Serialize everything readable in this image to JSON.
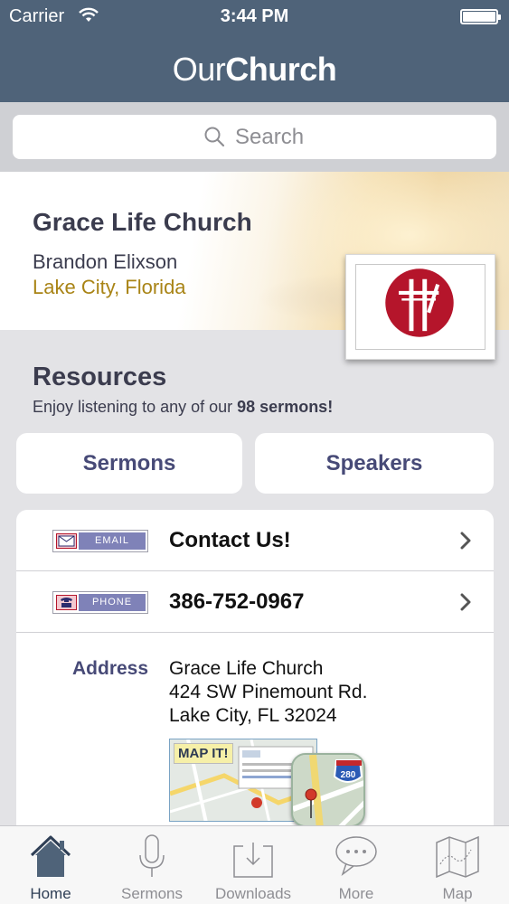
{
  "status_bar": {
    "carrier": "Carrier",
    "time": "3:44 PM"
  },
  "nav": {
    "title_light": "Our",
    "title_bold": "Church"
  },
  "search": {
    "placeholder": "Search"
  },
  "church": {
    "name": "Grace Life Church",
    "pastor": "Brandon Elixson",
    "location": "Lake City, Florida"
  },
  "resources": {
    "title": "Resources",
    "subtitle_prefix": "Enjoy listening to any of our ",
    "subtitle_bold": "98 sermons!",
    "buttons": {
      "sermons": "Sermons",
      "speakers": "Speakers"
    }
  },
  "contact": {
    "email_badge": "EMAIL",
    "email_text": "Contact Us!",
    "phone_badge": "PHONE",
    "phone_text": "386-752-0967",
    "address_label": "Address",
    "address_lines": [
      "Grace Life Church",
      "424 SW Pinemount Rd.",
      "Lake City, FL 32024"
    ],
    "map_tag": "MAP IT!",
    "map_shield": "280"
  },
  "tabs": [
    {
      "label": "Home",
      "icon": "home-icon",
      "active": true
    },
    {
      "label": "Sermons",
      "icon": "microphone-icon",
      "active": false
    },
    {
      "label": "Downloads",
      "icon": "download-icon",
      "active": false
    },
    {
      "label": "More",
      "icon": "chat-bubble-icon",
      "active": false
    },
    {
      "label": "Map",
      "icon": "map-icon",
      "active": false
    }
  ],
  "colors": {
    "nav_bg": "#4f6379",
    "accent_text": "#474a77",
    "location_gold": "#a98416",
    "logo_red": "#b5152b",
    "tab_active": "#2f3f56"
  }
}
